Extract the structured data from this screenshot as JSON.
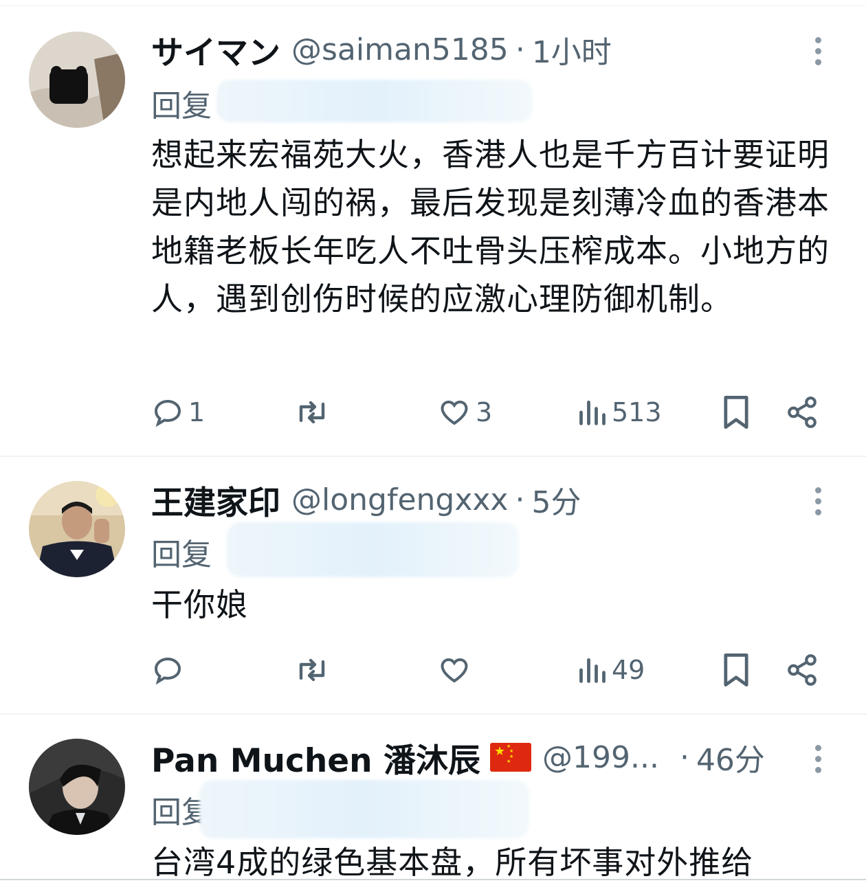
{
  "tweets": [
    {
      "name": "サイマン",
      "handle": "@saiman5185",
      "time": "1小时",
      "reply_prefix": "回复",
      "text": "想起来宏福苑大火，香港人也是千方百计要证明是内地人闯的祸，最后发现是刻薄冷血的香港本地籍老板长年吃人不吐骨头压榨成本。小地方的人，遇到创伤时候的应激心理防御机制。",
      "replies": "1",
      "retweets": "",
      "likes": "3",
      "views": "513"
    },
    {
      "name": "王建家印",
      "handle": "@longfengxxx",
      "time": "5分",
      "reply_prefix": "回复",
      "text": "干你娘",
      "replies": "",
      "retweets": "",
      "likes": "",
      "views": "49"
    },
    {
      "name": "Pan Muchen 潘沐辰",
      "handle": "@199...",
      "time": "46分",
      "reply_prefix": "回复",
      "text": "台湾4成的绿色基本盘，所有坏事对外推给",
      "flag": "china-flag"
    }
  ],
  "colors": {
    "text": "#0f1419",
    "muted": "#536471",
    "divider": "#eff3f4"
  }
}
